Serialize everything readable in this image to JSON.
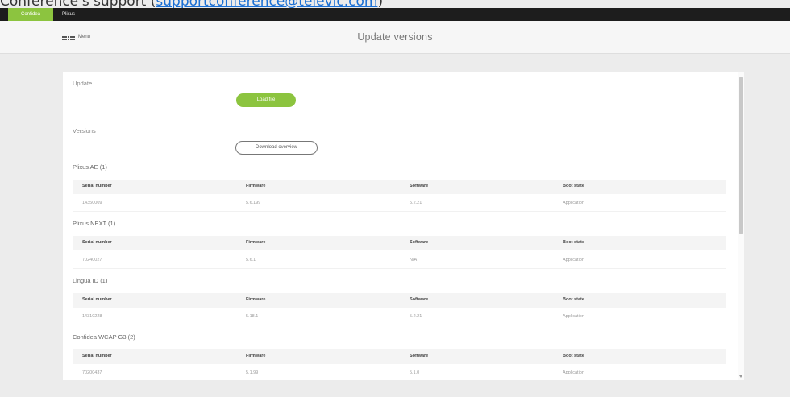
{
  "doc_text": {
    "prefix": "Conference's support (",
    "email": "supportconference@televic.com",
    "suffix": ")"
  },
  "topbar": {
    "tabs": [
      {
        "label": "Confidea"
      },
      {
        "label": "Plixus"
      }
    ]
  },
  "header": {
    "menu_label": "Menu",
    "title": "Update versions"
  },
  "update": {
    "label": "Update",
    "load_button": "Load file"
  },
  "versions": {
    "label": "Versions",
    "download_button": "Download overview",
    "columns": [
      "Serial number",
      "Firmware",
      "Software",
      "Boot state"
    ],
    "groups": [
      {
        "title": "Plixus AE (1)",
        "row": [
          "14350009",
          "5.6.199",
          "5.2.21",
          "Application"
        ]
      },
      {
        "title": "Plixus NEXT (1)",
        "row": [
          "70240027",
          "5.6.1",
          "N/A",
          "Application"
        ]
      },
      {
        "title": "Lingua ID (1)",
        "row": [
          "14310228",
          "5.18.1",
          "5.2.21",
          "Application"
        ]
      },
      {
        "title": "Confidea WCAP G3 (2)",
        "row": [
          "70200437",
          "5.1.99",
          "5.1.0",
          "Application"
        ]
      }
    ]
  },
  "colors": {
    "accent": "#8cc43f",
    "topbar": "#1d1d1d",
    "link": "#1a6fd4"
  }
}
